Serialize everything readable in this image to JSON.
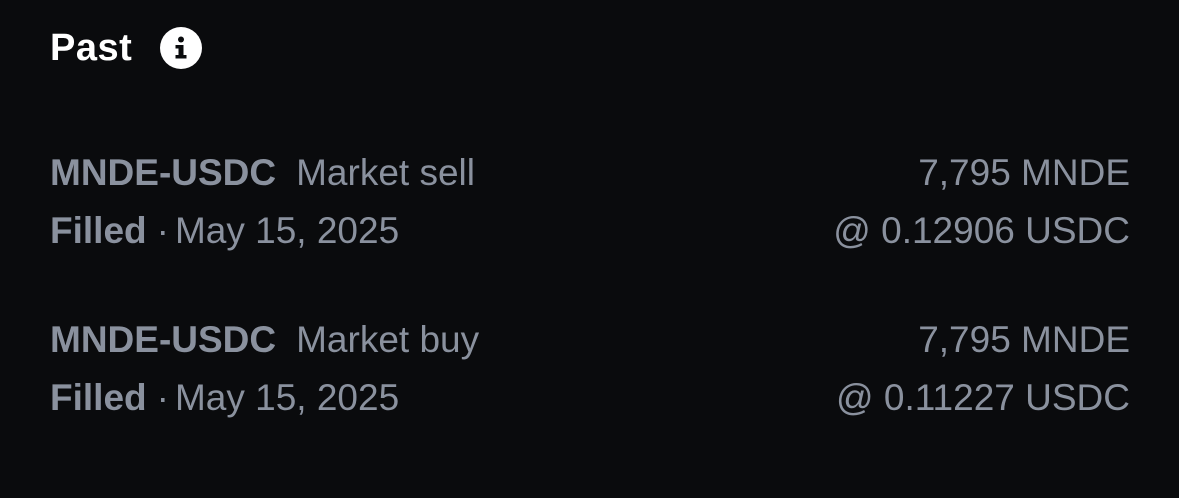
{
  "section": {
    "title": "Past",
    "icon": "info-icon"
  },
  "orders": [
    {
      "pair": "MNDE-USDC",
      "side": "Market sell",
      "status": "Filled",
      "separator": "·",
      "date": "May 15, 2025",
      "amount": "7,795 MNDE",
      "price": "@ 0.12906 USDC"
    },
    {
      "pair": "MNDE-USDC",
      "side": "Market buy",
      "status": "Filled",
      "separator": "·",
      "date": "May 15, 2025",
      "amount": "7,795 MNDE",
      "price": "@ 0.11227 USDC"
    }
  ],
  "colors": {
    "background": "#0a0b0d",
    "title": "#ffffff",
    "text_muted": "#8a919e"
  }
}
